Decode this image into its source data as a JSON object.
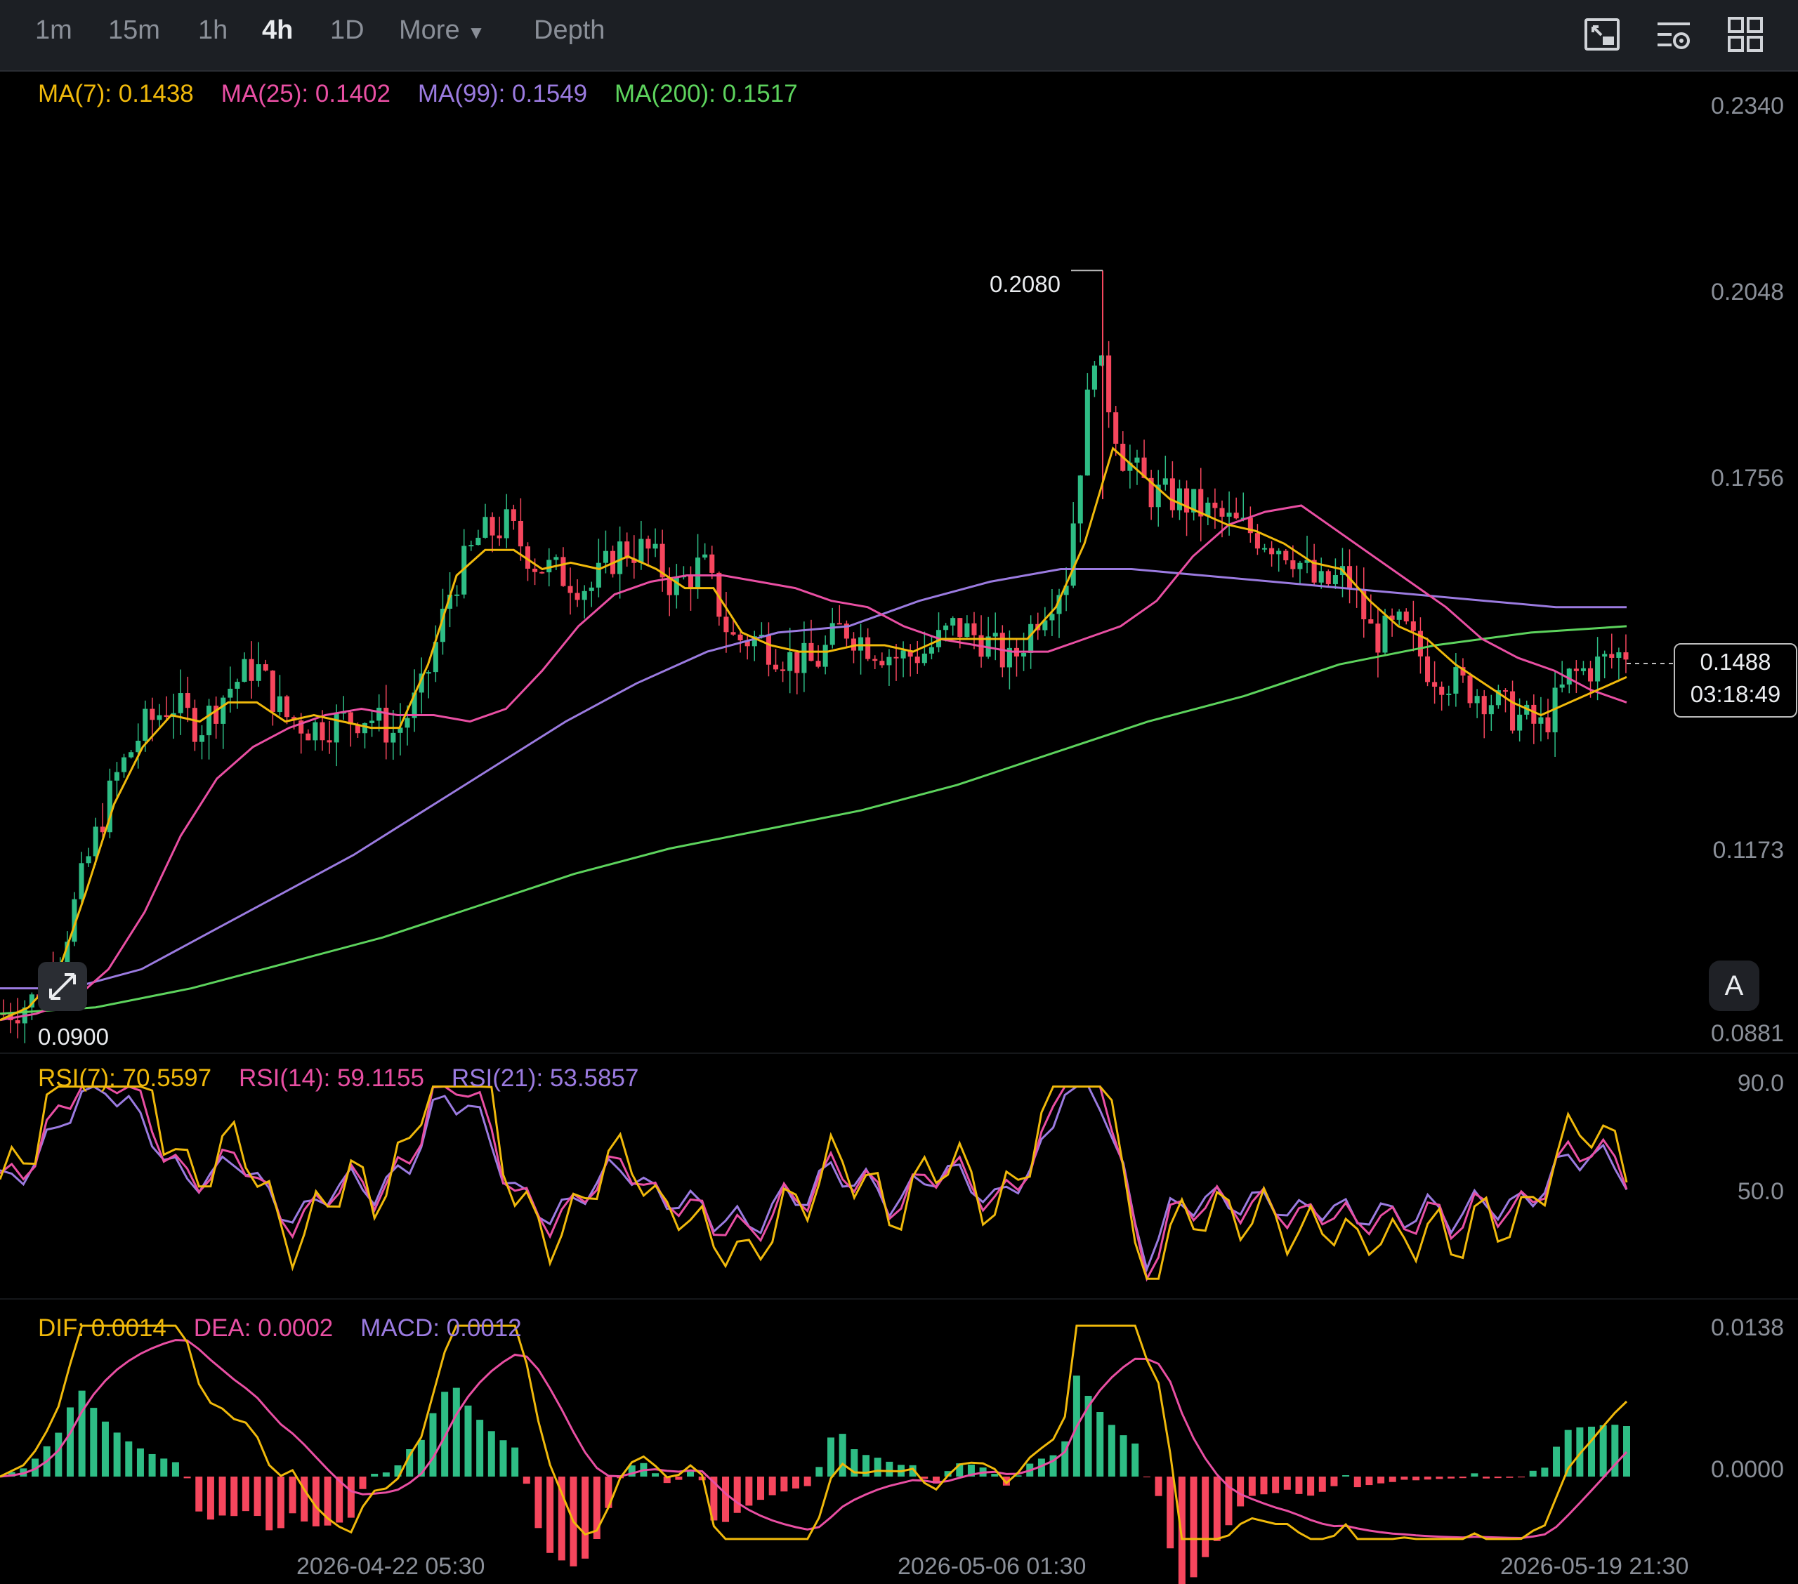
{
  "toolbar": {
    "timeframes": [
      "1m",
      "15m",
      "1h",
      "4h",
      "1D"
    ],
    "active": "4h",
    "more_label": "More",
    "depth_label": "Depth"
  },
  "ma_legend": {
    "ma7": {
      "label": "MA(7): 0.1438",
      "color": "#f0b90b"
    },
    "ma25": {
      "label": "MA(25): 0.1402",
      "color": "#e94fa3"
    },
    "ma99": {
      "label": "MA(99): 0.1549",
      "color": "#9b7be0"
    },
    "ma200": {
      "label": "MA(200): 0.1517",
      "color": "#5dd35d"
    }
  },
  "price_axis": [
    "0.2340",
    "0.2048",
    "0.1756",
    "0.1173",
    "0.0881"
  ],
  "high_label": "0.2080",
  "low_label": "0.0900",
  "last_price": "0.1488",
  "countdown": "03:18:49",
  "auto_button": "A",
  "rsi_legend": {
    "rsi7": {
      "label": "RSI(7): 70.5597",
      "color": "#f0b90b"
    },
    "rsi14": {
      "label": "RSI(14): 59.1155",
      "color": "#e94fa3"
    },
    "rsi21": {
      "label": "RSI(21): 53.5857",
      "color": "#9b7be0"
    }
  },
  "rsi_axis": [
    "90.0",
    "50.0"
  ],
  "macd_legend": {
    "dif": {
      "label": "DIF: 0.0014",
      "color": "#f0b90b"
    },
    "dea": {
      "label": "DEA: 0.0002",
      "color": "#e94fa3"
    },
    "macd": {
      "label": "MACD: 0.0012",
      "color": "#9b7be0"
    }
  },
  "macd_axis": [
    "0.0138",
    "0.0000"
  ],
  "dates": [
    "2026-04-22 05:30",
    "2026-05-06 01:30",
    "2026-05-19 21:30"
  ],
  "colors": {
    "up": "#2ebd85",
    "down": "#f6465d"
  },
  "chart_data": {
    "type": "line",
    "price_path_close": [
      0.091,
      0.093,
      0.1,
      0.115,
      0.128,
      0.136,
      0.14,
      0.136,
      0.142,
      0.146,
      0.138,
      0.136,
      0.137,
      0.138,
      0.135,
      0.142,
      0.158,
      0.166,
      0.168,
      0.162,
      0.16,
      0.158,
      0.164,
      0.164,
      0.158,
      0.162,
      0.15,
      0.15,
      0.147,
      0.146,
      0.152,
      0.149,
      0.147,
      0.148,
      0.152,
      0.15,
      0.146,
      0.154,
      0.16,
      0.196,
      0.179,
      0.173,
      0.172,
      0.17,
      0.168,
      0.166,
      0.164,
      0.158,
      0.16,
      0.15,
      0.152,
      0.145,
      0.143,
      0.141,
      0.138,
      0.136,
      0.144,
      0.146,
      0.148
    ],
    "ma7": [
      0.09,
      0.092,
      0.097,
      0.11,
      0.124,
      0.133,
      0.138,
      0.137,
      0.14,
      0.14,
      0.137,
      0.138,
      0.137,
      0.136,
      0.136,
      0.146,
      0.16,
      0.164,
      0.164,
      0.161,
      0.162,
      0.161,
      0.163,
      0.161,
      0.158,
      0.158,
      0.151,
      0.149,
      0.148,
      0.148,
      0.149,
      0.149,
      0.148,
      0.15,
      0.15,
      0.15,
      0.15,
      0.155,
      0.165,
      0.18,
      0.176,
      0.172,
      0.17,
      0.168,
      0.167,
      0.165,
      0.162,
      0.161,
      0.156,
      0.152,
      0.15,
      0.146,
      0.143,
      0.14,
      0.138,
      0.14,
      0.142,
      0.144
    ],
    "ma25": [
      0.09,
      0.091,
      0.093,
      0.098,
      0.107,
      0.119,
      0.128,
      0.133,
      0.136,
      0.138,
      0.139,
      0.138,
      0.138,
      0.137,
      0.139,
      0.145,
      0.152,
      0.157,
      0.159,
      0.16,
      0.16,
      0.159,
      0.158,
      0.156,
      0.155,
      0.152,
      0.15,
      0.149,
      0.148,
      0.148,
      0.15,
      0.152,
      0.156,
      0.163,
      0.168,
      0.17,
      0.171,
      0.167,
      0.163,
      0.159,
      0.155,
      0.15,
      0.147,
      0.145,
      0.142,
      0.14
    ],
    "ma99": [
      0.095,
      0.095,
      0.098,
      0.104,
      0.11,
      0.116,
      0.123,
      0.13,
      0.137,
      0.143,
      0.148,
      0.151,
      0.152,
      0.156,
      0.159,
      0.161,
      0.161,
      0.16,
      0.159,
      0.158,
      0.157,
      0.156,
      0.155,
      0.155
    ],
    "ma200": [
      0.091,
      0.092,
      0.095,
      0.099,
      0.103,
      0.108,
      0.113,
      0.117,
      0.12,
      0.123,
      0.127,
      0.132,
      0.137,
      0.141,
      0.146,
      0.149,
      0.151,
      0.152
    ],
    "rsi_range": [
      10,
      90
    ],
    "macd_range": [
      -0.006,
      0.0138
    ]
  }
}
